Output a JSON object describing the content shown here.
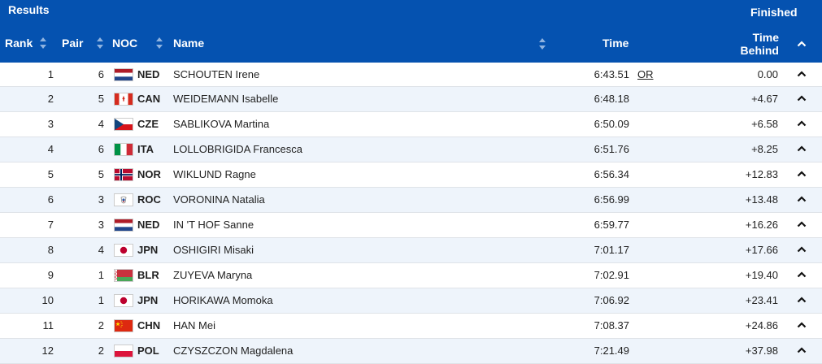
{
  "header": {
    "title": "Results",
    "status": "Finished",
    "columns": {
      "rank": "Rank",
      "pair": "Pair",
      "noc": "NOC",
      "name": "Name",
      "time": "Time",
      "time_behind_line1": "Time",
      "time_behind_line2": "Behind"
    }
  },
  "colors": {
    "header_bg": "#0552b0",
    "alt_row_bg": "#eef4fb"
  },
  "rows": [
    {
      "rank": "1",
      "pair": "6",
      "flag": "NED",
      "noc": "NED",
      "name": "SCHOUTEN Irene",
      "time": "6:43.51",
      "record": "OR",
      "behind": "0.00"
    },
    {
      "rank": "2",
      "pair": "5",
      "flag": "CAN",
      "noc": "CAN",
      "name": "WEIDEMANN Isabelle",
      "time": "6:48.18",
      "record": "",
      "behind": "+4.67"
    },
    {
      "rank": "3",
      "pair": "4",
      "flag": "CZE",
      "noc": "CZE",
      "name": "SABLIKOVA Martina",
      "time": "6:50.09",
      "record": "",
      "behind": "+6.58"
    },
    {
      "rank": "4",
      "pair": "6",
      "flag": "ITA",
      "noc": "ITA",
      "name": "LOLLOBRIGIDA Francesca",
      "time": "6:51.76",
      "record": "",
      "behind": "+8.25"
    },
    {
      "rank": "5",
      "pair": "5",
      "flag": "NOR",
      "noc": "NOR",
      "name": "WIKLUND Ragne",
      "time": "6:56.34",
      "record": "",
      "behind": "+12.83"
    },
    {
      "rank": "6",
      "pair": "3",
      "flag": "ROC",
      "noc": "ROC",
      "name": "VORONINA Natalia",
      "time": "6:56.99",
      "record": "",
      "behind": "+13.48"
    },
    {
      "rank": "7",
      "pair": "3",
      "flag": "NED",
      "noc": "NED",
      "name": "IN 'T HOF Sanne",
      "time": "6:59.77",
      "record": "",
      "behind": "+16.26"
    },
    {
      "rank": "8",
      "pair": "4",
      "flag": "JPN",
      "noc": "JPN",
      "name": "OSHIGIRI Misaki",
      "time": "7:01.17",
      "record": "",
      "behind": "+17.66"
    },
    {
      "rank": "9",
      "pair": "1",
      "flag": "BLR",
      "noc": "BLR",
      "name": "ZUYEVA Maryna",
      "time": "7:02.91",
      "record": "",
      "behind": "+19.40"
    },
    {
      "rank": "10",
      "pair": "1",
      "flag": "JPN",
      "noc": "JPN",
      "name": "HORIKAWA Momoka",
      "time": "7:06.92",
      "record": "",
      "behind": "+23.41"
    },
    {
      "rank": "11",
      "pair": "2",
      "flag": "CHN",
      "noc": "CHN",
      "name": "HAN Mei",
      "time": "7:08.37",
      "record": "",
      "behind": "+24.86"
    },
    {
      "rank": "12",
      "pair": "2",
      "flag": "POL",
      "noc": "POL",
      "name": "CZYSZCZON Magdalena",
      "time": "7:21.49",
      "record": "",
      "behind": "+37.98"
    }
  ]
}
